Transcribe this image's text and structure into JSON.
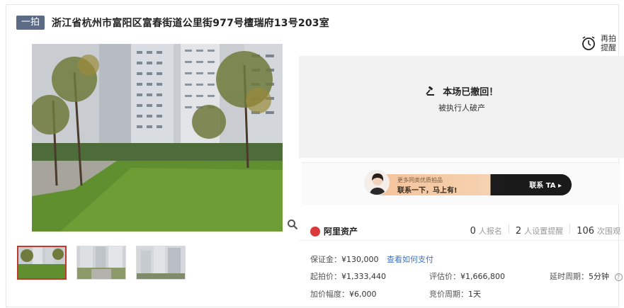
{
  "header": {
    "tag": "一拍",
    "title": "浙江省杭州市富阳区富春街道公里街977号檀瑞府13号203室"
  },
  "remind": {
    "label": "再拍提醒"
  },
  "status": {
    "headline": "本场已撤回！",
    "reason": "被执行人破产"
  },
  "contact": {
    "line1": "更多同类优质拍品",
    "line2": "联系一下，马上有!",
    "button": "联系 TA"
  },
  "brand": {
    "name": "阿里资产"
  },
  "stats": [
    {
      "num": "0",
      "label": "人报名"
    },
    {
      "num": "2",
      "label": "人设置提醒"
    },
    {
      "num": "106",
      "label": "次围观"
    }
  ],
  "details": {
    "deposit_label": "保证金：",
    "deposit_value": "¥130,000",
    "pay_link": "查看如何支付",
    "start_label": "起拍价：",
    "start_value": "¥1,333,440",
    "eval_label": "评估价：",
    "eval_value": "¥1,666,800",
    "delay_label": "延时周期：",
    "delay_value": "5分钟",
    "inc_label": "加价幅度：",
    "inc_value": "¥6,000",
    "cycle_label": "竞价周期：",
    "cycle_value": "1天"
  },
  "colors": {
    "tag_bg": "#5b6b86",
    "link": "#3a73c9",
    "thumb_active": "#c0392b",
    "brand": "#d93a3a"
  },
  "icons": [
    "alarm-clock-icon",
    "gavel-icon",
    "zoom-icon",
    "help-icon",
    "play-arrow-icon"
  ]
}
